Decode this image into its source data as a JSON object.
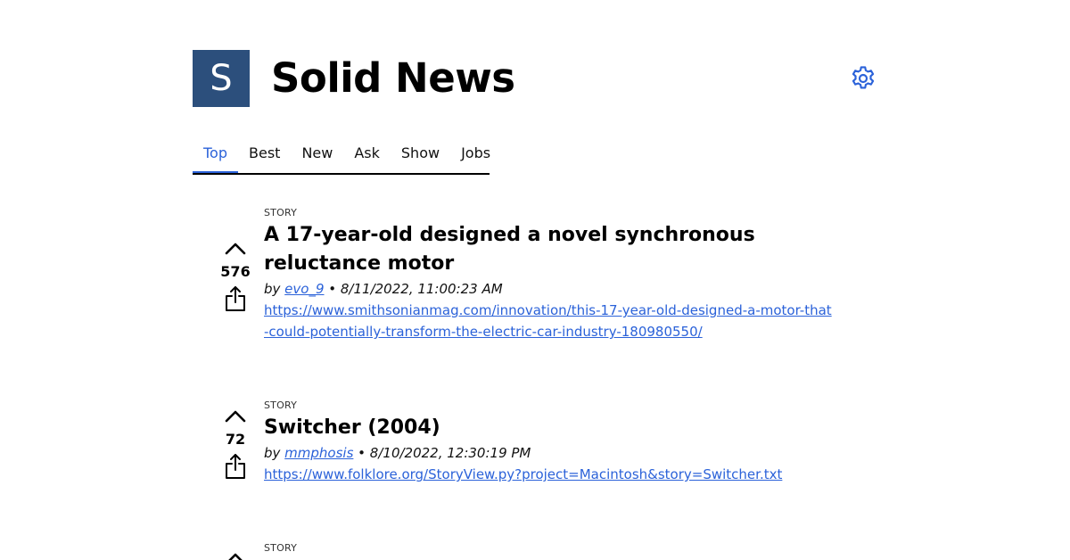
{
  "header": {
    "logo_letter": "S",
    "title": "Solid News",
    "settings_icon": "gear-icon",
    "accent_color": "#2b62d9",
    "logo_color": "#2c4f7c"
  },
  "tabs": [
    {
      "label": "Top",
      "active": true
    },
    {
      "label": "Best",
      "active": false
    },
    {
      "label": "New",
      "active": false
    },
    {
      "label": "Ask",
      "active": false
    },
    {
      "label": "Show",
      "active": false
    },
    {
      "label": "Jobs",
      "active": false
    }
  ],
  "stories": [
    {
      "kind": "STORY",
      "title": "A 17-year-old designed a novel synchronous reluctance motor",
      "score": "576",
      "by_label": "by ",
      "author": "evo_9",
      "separator": " • ",
      "time": "8/11/2022, 11:00:23 AM",
      "url": "https://www.smithsonianmag.com/innovation/this-17-year-old-designed-a-motor-that-could-potentially-transform-the-electric-car-industry-180980550/"
    },
    {
      "kind": "STORY",
      "title": "Switcher (2004)",
      "score": "72",
      "by_label": "by ",
      "author": "mmphosis",
      "separator": " • ",
      "time": "8/10/2022, 12:30:19 PM",
      "url": "https://www.folklore.org/StoryView.py?project=Macintosh&story=Switcher.txt"
    },
    {
      "kind": "STORY"
    }
  ]
}
